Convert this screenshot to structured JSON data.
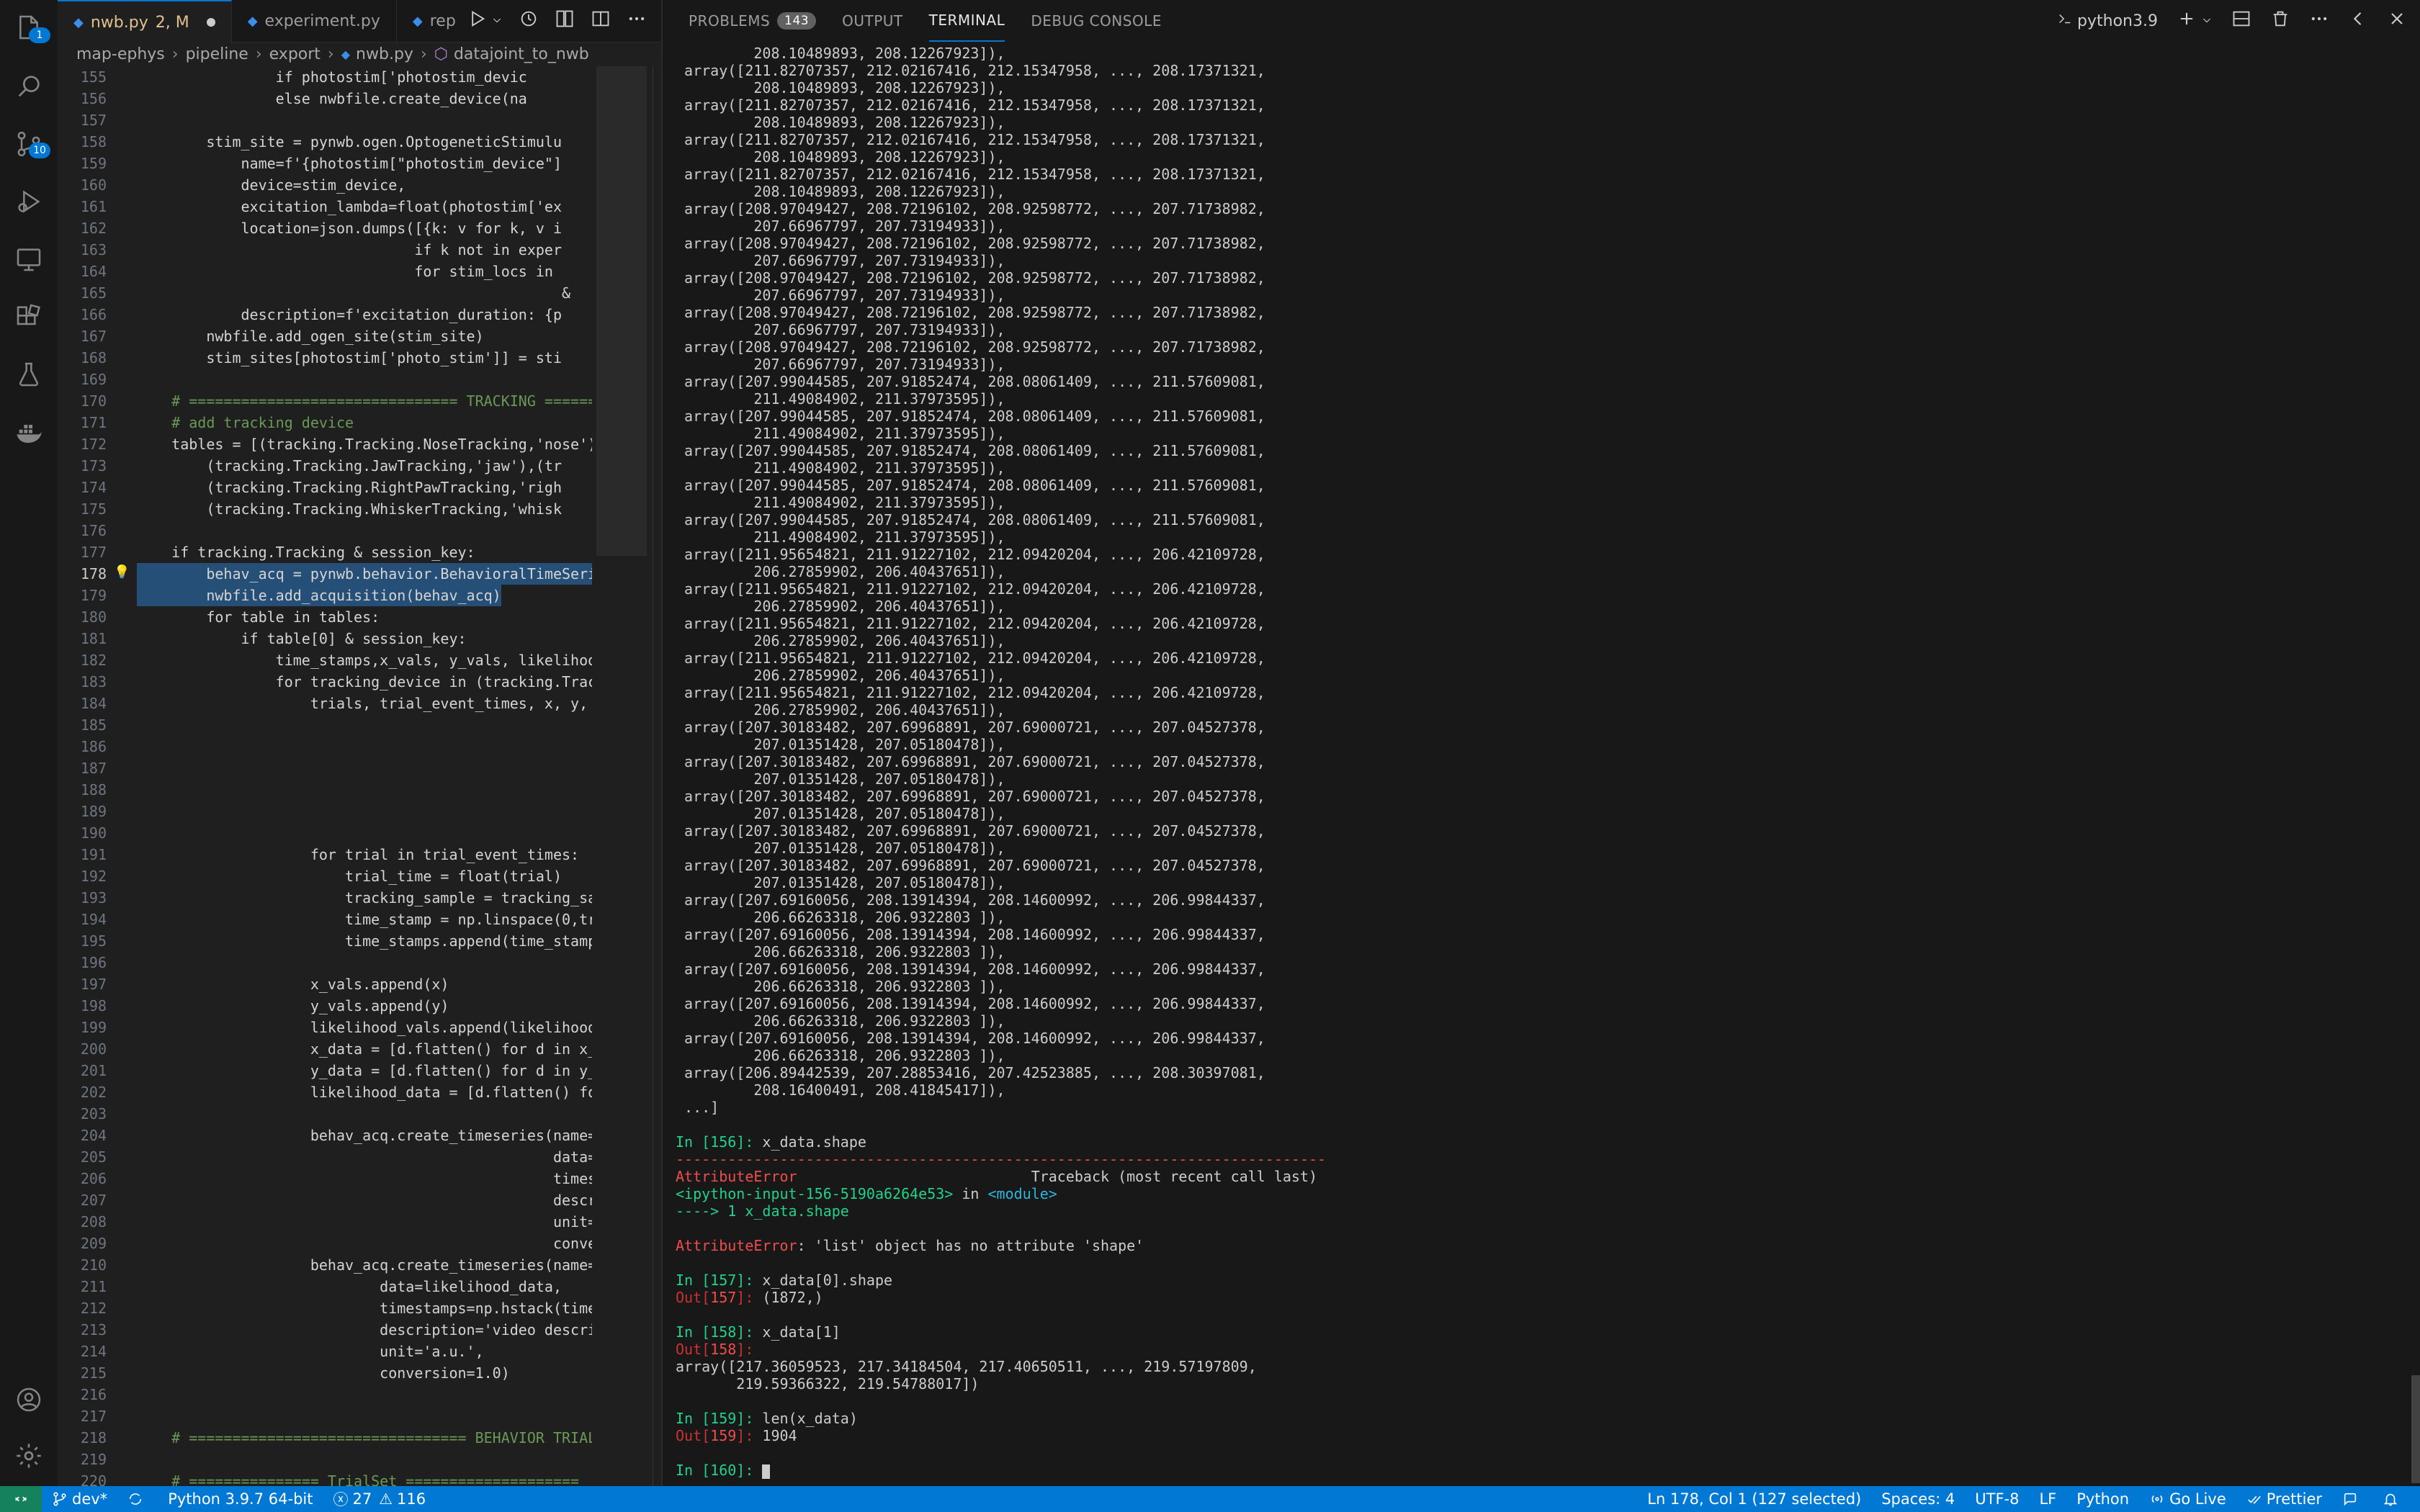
{
  "activity_bar": {
    "explorer_badge": "1",
    "source_control_badge": "10"
  },
  "editor": {
    "tabs": [
      {
        "label": "nwb.py",
        "modified": "2, M",
        "active": true
      },
      {
        "label": "experiment.py",
        "active": false
      },
      {
        "label": "repo",
        "active": false
      }
    ],
    "breadcrumb": [
      "map-ephys",
      "pipeline",
      "export",
      "nwb.py",
      "datajoint_to_nwb"
    ],
    "current_line": "178",
    "lines": [
      {
        "n": "155",
        "t": "                if photostim['photostim_devic"
      },
      {
        "n": "156",
        "t": "                else nwbfile.create_device(na"
      },
      {
        "n": "157",
        "t": ""
      },
      {
        "n": "158",
        "t": "        stim_site = pynwb.ogen.OptogeneticStimulu"
      },
      {
        "n": "159",
        "t": "            name=f'{photostim[\"photostim_device\"]"
      },
      {
        "n": "160",
        "t": "            device=stim_device,"
      },
      {
        "n": "161",
        "t": "            excitation_lambda=float(photostim['ex"
      },
      {
        "n": "162",
        "t": "            location=json.dumps([{k: v for k, v i"
      },
      {
        "n": "163",
        "t": "                                if k not in exper"
      },
      {
        "n": "164",
        "t": "                                for stim_locs in "
      },
      {
        "n": "165",
        "t": "                                                 &"
      },
      {
        "n": "166",
        "t": "            description=f'excitation_duration: {p"
      },
      {
        "n": "167",
        "t": "        nwbfile.add_ogen_site(stim_site)"
      },
      {
        "n": "168",
        "t": "        stim_sites[photostim['photo_stim']] = sti"
      },
      {
        "n": "169",
        "t": ""
      },
      {
        "n": "170",
        "t": "    # =============================== TRACKING ======"
      },
      {
        "n": "171",
        "t": "    # add tracking device"
      },
      {
        "n": "172",
        "t": "    tables = [(tracking.Tracking.NoseTracking,'nose')"
      },
      {
        "n": "173",
        "t": "        (tracking.Tracking.JawTracking,'jaw'),(tr"
      },
      {
        "n": "174",
        "t": "        (tracking.Tracking.RightPawTracking,'righ"
      },
      {
        "n": "175",
        "t": "        (tracking.Tracking.WhiskerTracking,'whisk"
      },
      {
        "n": "176",
        "t": ""
      },
      {
        "n": "177",
        "t": "    if tracking.Tracking & session_key:"
      },
      {
        "n": "178",
        "t": "        behav_acq = pynwb.behavior.BehavioralTimeSeri",
        "hl": true
      },
      {
        "n": "179",
        "t": "        nwbfile.add_acquisition(behav_acq)",
        "hl": true
      },
      {
        "n": "180",
        "t": "        for table in tables:"
      },
      {
        "n": "181",
        "t": "            if table[0] & session_key:"
      },
      {
        "n": "182",
        "t": "                time_stamps,x_vals, y_vals, likelihoo"
      },
      {
        "n": "183",
        "t": "                for tracking_device in (tracking.Trac"
      },
      {
        "n": "184",
        "t": "                    trials, trial_event_times, x, y,"
      },
      {
        "n": "185",
        "t": ""
      },
      {
        "n": "186",
        "t": ""
      },
      {
        "n": "187",
        "t": ""
      },
      {
        "n": "188",
        "t": ""
      },
      {
        "n": "189",
        "t": ""
      },
      {
        "n": "190",
        "t": ""
      },
      {
        "n": "191",
        "t": "                    for trial in trial_event_times:"
      },
      {
        "n": "192",
        "t": "                        trial_time = float(trial)"
      },
      {
        "n": "193",
        "t": "                        tracking_sample = tracking_sa"
      },
      {
        "n": "194",
        "t": "                        time_stamp = np.linspace(0,tr"
      },
      {
        "n": "195",
        "t": "                        time_stamps.append(time_stamp"
      },
      {
        "n": "196",
        "t": ""
      },
      {
        "n": "197",
        "t": "                    x_vals.append(x)"
      },
      {
        "n": "198",
        "t": "                    y_vals.append(y)"
      },
      {
        "n": "199",
        "t": "                    likelihood_vals.append(likelihood"
      },
      {
        "n": "200",
        "t": "                    x_data = [d.flatten() for d in x_"
      },
      {
        "n": "201",
        "t": "                    y_data = [d.flatten() for d in y_"
      },
      {
        "n": "202",
        "t": "                    likelihood_data = [d.flatten() fo"
      },
      {
        "n": "203",
        "t": ""
      },
      {
        "n": "204",
        "t": "                    behav_acq.create_timeseries(name="
      },
      {
        "n": "205",
        "t": "                                                data="
      },
      {
        "n": "206",
        "t": "                                                times"
      },
      {
        "n": "207",
        "t": "                                                descr"
      },
      {
        "n": "208",
        "t": "                                                unit="
      },
      {
        "n": "209",
        "t": "                                                conve"
      },
      {
        "n": "210",
        "t": "                    behav_acq.create_timeseries(name="
      },
      {
        "n": "211",
        "t": "                            data=likelihood_data,"
      },
      {
        "n": "212",
        "t": "                            timestamps=np.hstack(time"
      },
      {
        "n": "213",
        "t": "                            description='video descri"
      },
      {
        "n": "214",
        "t": "                            unit='a.u.',"
      },
      {
        "n": "215",
        "t": "                            conversion=1.0)"
      },
      {
        "n": "216",
        "t": ""
      },
      {
        "n": "217",
        "t": ""
      },
      {
        "n": "218",
        "t": "    # ================================ BEHAVIOR TRIALS"
      },
      {
        "n": "219",
        "t": ""
      },
      {
        "n": "220",
        "t": "    # =============== TrialSet ===================="
      }
    ]
  },
  "panel": {
    "tabs": [
      {
        "label": "PROBLEMS",
        "badge": "143"
      },
      {
        "label": "OUTPUT"
      },
      {
        "label": "TERMINAL",
        "active": true
      },
      {
        "label": "DEBUG CONSOLE"
      }
    ],
    "terminal_profile": "python3.9",
    "terminal_lines": [
      "         208.10489893, 208.12267923]),",
      " array([211.82707357, 212.02167416, 212.15347958, ..., 208.17371321,",
      "         208.10489893, 208.12267923]),",
      " array([211.82707357, 212.02167416, 212.15347958, ..., 208.17371321,",
      "         208.10489893, 208.12267923]),",
      " array([211.82707357, 212.02167416, 212.15347958, ..., 208.17371321,",
      "         208.10489893, 208.12267923]),",
      " array([211.82707357, 212.02167416, 212.15347958, ..., 208.17371321,",
      "         208.10489893, 208.12267923]),",
      " array([208.97049427, 208.72196102, 208.92598772, ..., 207.71738982,",
      "         207.66967797, 207.73194933]),",
      " array([208.97049427, 208.72196102, 208.92598772, ..., 207.71738982,",
      "         207.66967797, 207.73194933]),",
      " array([208.97049427, 208.72196102, 208.92598772, ..., 207.71738982,",
      "         207.66967797, 207.73194933]),",
      " array([208.97049427, 208.72196102, 208.92598772, ..., 207.71738982,",
      "         207.66967797, 207.73194933]),",
      " array([208.97049427, 208.72196102, 208.92598772, ..., 207.71738982,",
      "         207.66967797, 207.73194933]),",
      " array([207.99044585, 207.91852474, 208.08061409, ..., 211.57609081,",
      "         211.49084902, 211.37973595]),",
      " array([207.99044585, 207.91852474, 208.08061409, ..., 211.57609081,",
      "         211.49084902, 211.37973595]),",
      " array([207.99044585, 207.91852474, 208.08061409, ..., 211.57609081,",
      "         211.49084902, 211.37973595]),",
      " array([207.99044585, 207.91852474, 208.08061409, ..., 211.57609081,",
      "         211.49084902, 211.37973595]),",
      " array([207.99044585, 207.91852474, 208.08061409, ..., 211.57609081,",
      "         211.49084902, 211.37973595]),",
      " array([211.95654821, 211.91227102, 212.09420204, ..., 206.42109728,",
      "         206.27859902, 206.40437651]),",
      " array([211.95654821, 211.91227102, 212.09420204, ..., 206.42109728,",
      "         206.27859902, 206.40437651]),",
      " array([211.95654821, 211.91227102, 212.09420204, ..., 206.42109728,",
      "         206.27859902, 206.40437651]),",
      " array([211.95654821, 211.91227102, 212.09420204, ..., 206.42109728,",
      "         206.27859902, 206.40437651]),",
      " array([211.95654821, 211.91227102, 212.09420204, ..., 206.42109728,",
      "         206.27859902, 206.40437651]),",
      " array([207.30183482, 207.69968891, 207.69000721, ..., 207.04527378,",
      "         207.01351428, 207.05180478]),",
      " array([207.30183482, 207.69968891, 207.69000721, ..., 207.04527378,",
      "         207.01351428, 207.05180478]),",
      " array([207.30183482, 207.69968891, 207.69000721, ..., 207.04527378,",
      "         207.01351428, 207.05180478]),",
      " array([207.30183482, 207.69968891, 207.69000721, ..., 207.04527378,",
      "         207.01351428, 207.05180478]),",
      " array([207.30183482, 207.69968891, 207.69000721, ..., 207.04527378,",
      "         207.01351428, 207.05180478]),",
      " array([207.69160056, 208.13914394, 208.14600992, ..., 206.99844337,",
      "         206.66263318, 206.9322803 ]),",
      " array([207.69160056, 208.13914394, 208.14600992, ..., 206.99844337,",
      "         206.66263318, 206.9322803 ]),",
      " array([207.69160056, 208.13914394, 208.14600992, ..., 206.99844337,",
      "         206.66263318, 206.9322803 ]),",
      " array([207.69160056, 208.13914394, 208.14600992, ..., 206.99844337,",
      "         206.66263318, 206.9322803 ]),",
      " array([207.69160056, 208.13914394, 208.14600992, ..., 206.99844337,",
      "         206.66263318, 206.9322803 ]),",
      " array([206.89442539, 207.28853416, 207.42523885, ..., 208.30397081,",
      "         208.16400491, 208.41845417]),",
      " ...]"
    ],
    "session": [
      {
        "kind": "in",
        "num": "156",
        "code": "x_data.shape"
      },
      {
        "kind": "rule",
        "text": "---------------------------------------------------------------------------"
      },
      {
        "kind": "err_head",
        "name": "AttributeError",
        "tb": "Traceback (most recent call last)"
      },
      {
        "kind": "err_loc",
        "input": "<ipython-input-156-5190a6264e53>",
        "in": " in ",
        "module": "<module>"
      },
      {
        "kind": "err_arrow",
        "text": "----> 1 x_data.shape"
      },
      {
        "kind": "blank"
      },
      {
        "kind": "err_msg",
        "name": "AttributeError",
        "msg": ": 'list' object has no attribute 'shape'"
      },
      {
        "kind": "blank"
      },
      {
        "kind": "in",
        "num": "157",
        "code": "x_data[0].shape"
      },
      {
        "kind": "out",
        "num": "157",
        "text": "(1872,)"
      },
      {
        "kind": "blank"
      },
      {
        "kind": "in",
        "num": "158",
        "code": "x_data[1]"
      },
      {
        "kind": "out",
        "num": "158",
        "text": ""
      },
      {
        "kind": "plain",
        "text": "array([217.36059523, 217.34184504, 217.40650511, ..., 219.57197809,"
      },
      {
        "kind": "plain",
        "text": "       219.59366322, 219.54788017])"
      },
      {
        "kind": "blank"
      },
      {
        "kind": "in",
        "num": "159",
        "code": "len(x_data)"
      },
      {
        "kind": "out",
        "num": "159",
        "text": "1904"
      },
      {
        "kind": "blank"
      },
      {
        "kind": "in",
        "num": "160",
        "code": ""
      }
    ]
  },
  "status_bar": {
    "branch": "dev*",
    "interpreter": "Python 3.9.7 64-bit",
    "errors": "27",
    "warnings": "116",
    "cursor": "Ln 178, Col 1 (127 selected)",
    "spaces": "Spaces: 4",
    "encoding": "UTF-8",
    "eol": "LF",
    "language": "Python",
    "go_live": "Go Live",
    "prettier": "Prettier"
  }
}
